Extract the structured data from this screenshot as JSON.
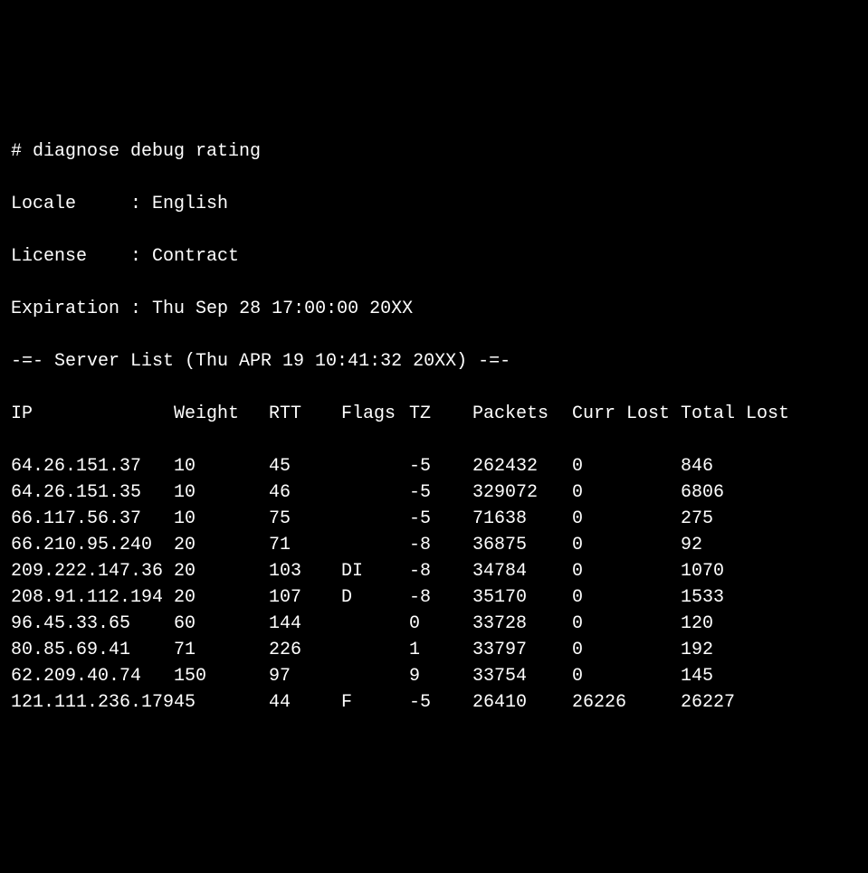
{
  "command": "# diagnose debug rating",
  "meta": {
    "locale_label": "Locale",
    "locale_value": "English",
    "license_label": "License",
    "license_value": "Contract",
    "expiration_label": "Expiration",
    "expiration_value": "Thu Sep 28 17:00:00 20XX"
  },
  "server_list_header": "-=- Server List (Thu APR 19 10:41:32 20XX) -=-",
  "columns": {
    "ip": "IP",
    "weight": "Weight",
    "rtt": "RTT",
    "flags": "Flags",
    "tz": "TZ",
    "packets": "Packets",
    "curr_lost": "Curr Lost",
    "total_lost": "Total Lost"
  },
  "rows": [
    {
      "ip": "64.26.151.37",
      "weight": "10",
      "rtt": "45",
      "flags": "",
      "tz": "-5",
      "packets": "262432",
      "curr_lost": "0",
      "total_lost": "846"
    },
    {
      "ip": "64.26.151.35",
      "weight": "10",
      "rtt": "46",
      "flags": "",
      "tz": "-5",
      "packets": "329072",
      "curr_lost": "0",
      "total_lost": "6806"
    },
    {
      "ip": "66.117.56.37",
      "weight": "10",
      "rtt": "75",
      "flags": "",
      "tz": "-5",
      "packets": "71638",
      "curr_lost": "0",
      "total_lost": "275"
    },
    {
      "ip": "66.210.95.240",
      "weight": "20",
      "rtt": "71",
      "flags": "",
      "tz": "-8",
      "packets": "36875",
      "curr_lost": "0",
      "total_lost": "92"
    },
    {
      "ip": "209.222.147.36",
      "weight": "20",
      "rtt": "103",
      "flags": "DI",
      "tz": "-8",
      "packets": "34784",
      "curr_lost": "0",
      "total_lost": "1070"
    },
    {
      "ip": "208.91.112.194",
      "weight": "20",
      "rtt": "107",
      "flags": "D",
      "tz": "-8",
      "packets": "35170",
      "curr_lost": "0",
      "total_lost": "1533"
    },
    {
      "ip": "96.45.33.65",
      "weight": "60",
      "rtt": "144",
      "flags": "",
      "tz": "0",
      "packets": "33728",
      "curr_lost": "0",
      "total_lost": "120"
    },
    {
      "ip": "80.85.69.41",
      "weight": "71",
      "rtt": "226",
      "flags": "",
      "tz": "1",
      "packets": "33797",
      "curr_lost": "0",
      "total_lost": "192"
    },
    {
      "ip": "62.209.40.74",
      "weight": "150",
      "rtt": "97",
      "flags": "",
      "tz": "9",
      "packets": "33754",
      "curr_lost": "0",
      "total_lost": "145"
    },
    {
      "ip": "121.111.236.179",
      "weight": "45",
      "rtt": "44",
      "flags": "F",
      "tz": "-5",
      "packets": "26410",
      "curr_lost": "26226",
      "total_lost": "26227"
    }
  ]
}
